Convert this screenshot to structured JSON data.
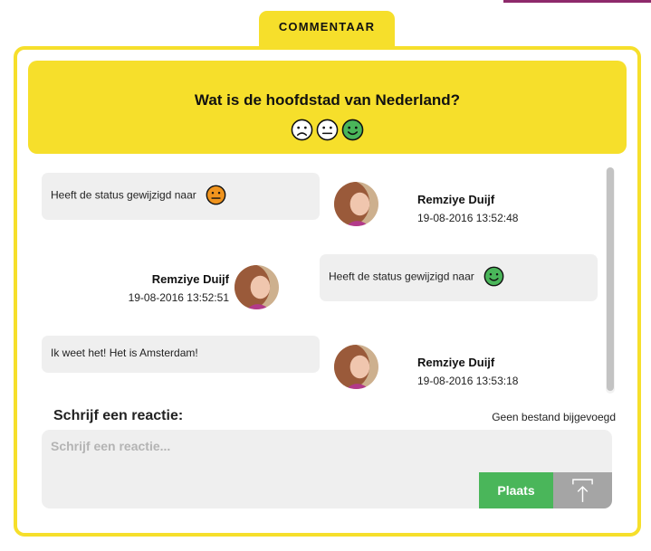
{
  "tab": {
    "label": "COMMENTAAR"
  },
  "question": {
    "text": "Wat is de hoofdstad van Nederland?",
    "ratings": [
      {
        "icon": "sad-face-icon",
        "selected": false
      },
      {
        "icon": "neutral-face-icon",
        "selected": false
      },
      {
        "icon": "happy-face-icon",
        "selected": true,
        "color": "#4ab65a"
      }
    ]
  },
  "messages": [
    {
      "text": "Heeft de status gewijzigd naar",
      "status_icon": "neutral-face-icon",
      "status_color": "#f0941e",
      "author": "Remziye Duijf",
      "timestamp": "19-08-2016 13:52:48",
      "side": "left"
    },
    {
      "text": "Heeft de status gewijzigd naar",
      "status_icon": "happy-face-icon",
      "status_color": "#4ab65a",
      "author": "Remziye Duijf",
      "timestamp": "19-08-2016 13:52:51",
      "side": "right"
    },
    {
      "text": "Ik weet het! Het is Amsterdam!",
      "author": "Remziye Duijf",
      "timestamp": "19-08-2016 13:53:18",
      "side": "left"
    }
  ],
  "composer": {
    "label": "Schrijf een reactie:",
    "placeholder": "Schrijf een reactie...",
    "attachment_status": "Geen bestand bijgevoegd",
    "post_label": "Plaats",
    "upload_icon": "upload-icon"
  },
  "colors": {
    "accent": "#f6df2b",
    "bubble": "#efefef",
    "post_button": "#4ab65a",
    "upload_button": "#a5a5a5"
  }
}
